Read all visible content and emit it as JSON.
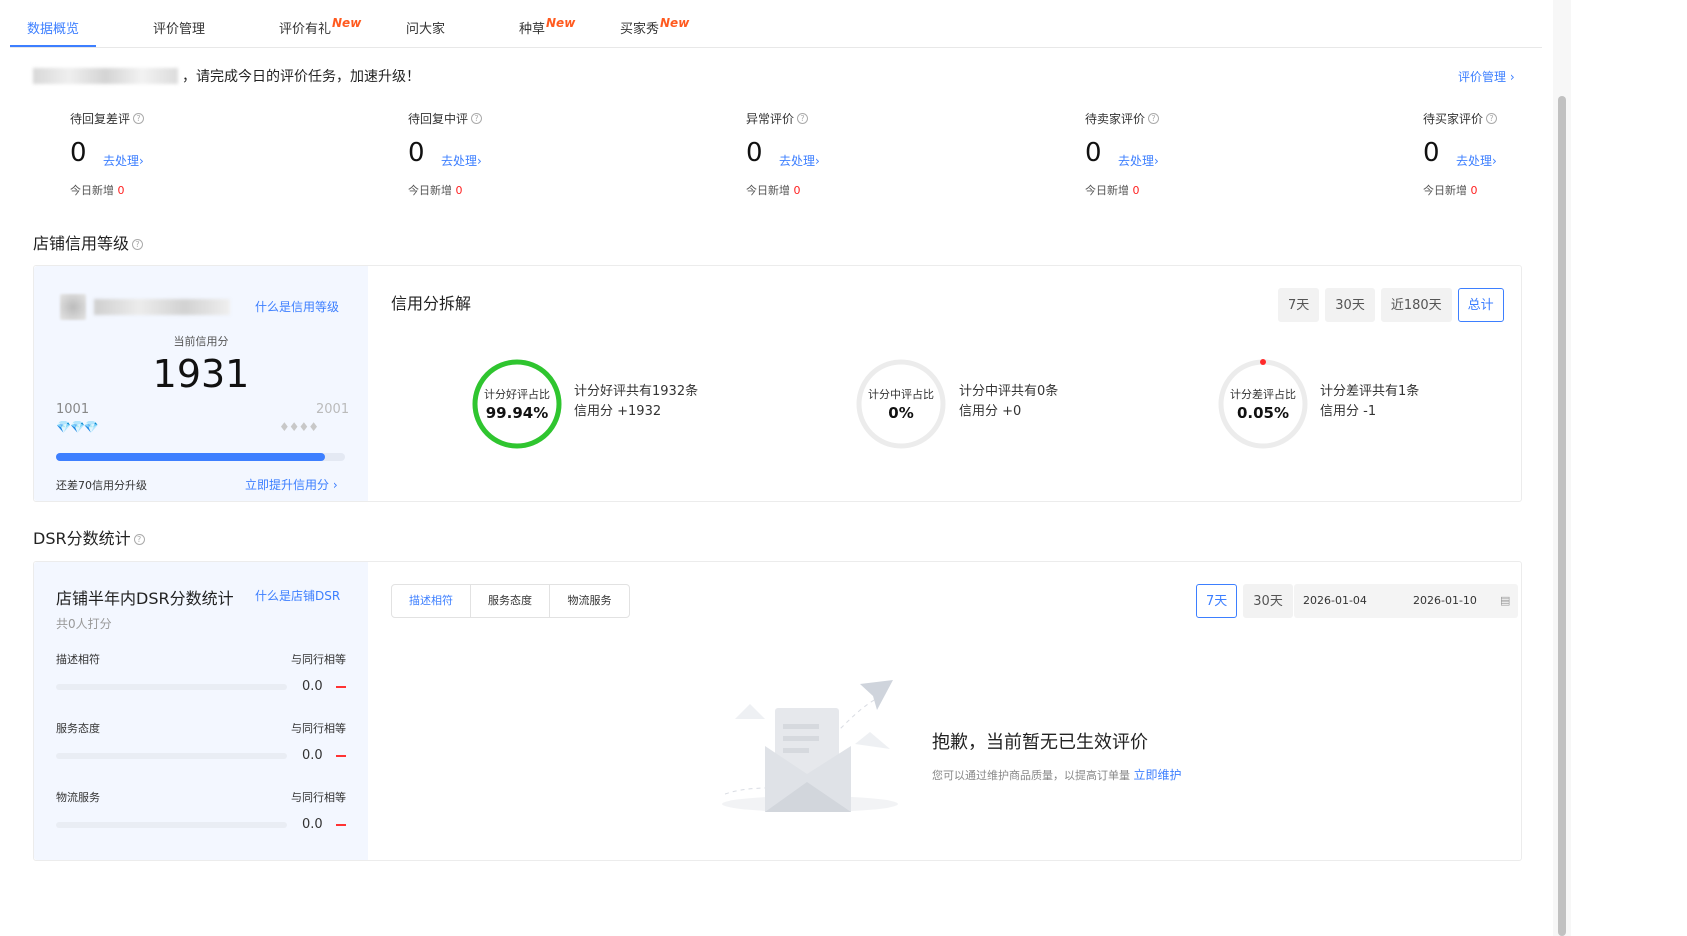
{
  "tabs": [
    {
      "label": "数据概览",
      "new": ""
    },
    {
      "label": "评价管理",
      "new": ""
    },
    {
      "label": "评价有礼",
      "new": "New"
    },
    {
      "label": "问大家",
      "new": ""
    },
    {
      "label": "种草",
      "new": "New"
    },
    {
      "label": "买家秀",
      "new": "New"
    }
  ],
  "notice": {
    "text": "，请完成今日的评价任务，加速升级！",
    "link": "评价管理"
  },
  "stats": [
    {
      "label": "待回复差评",
      "value": "0",
      "action": "去处理",
      "today_label": "今日新增",
      "today_value": "0"
    },
    {
      "label": "待回复中评",
      "value": "0",
      "action": "去处理",
      "today_label": "今日新增",
      "today_value": "0"
    },
    {
      "label": "异常评价",
      "value": "0",
      "action": "去处理",
      "today_label": "今日新增",
      "today_value": "0"
    },
    {
      "label": "待卖家评价",
      "value": "0",
      "action": "去处理",
      "today_label": "今日新增",
      "today_value": "0"
    },
    {
      "label": "待买家评价",
      "value": "0",
      "action": "去处理",
      "today_label": "今日新增",
      "today_value": "0"
    }
  ],
  "credit": {
    "section_title": "店铺信用等级",
    "what_link": "什么是信用等级",
    "current_label": "当前信用分",
    "score": "1931",
    "range_low": "1001",
    "range_high": "2001",
    "progress": 0.93,
    "remain_text": "还差70信用分升级",
    "boost_link": "立即提升信用分",
    "breakdown_title": "信用分拆解",
    "periods": [
      "7天",
      "30天",
      "近180天",
      "总计"
    ],
    "active_period": "总计",
    "items": [
      {
        "ring_label": "计分好评占比",
        "percent": "99.94%",
        "ratio": 0.9994,
        "color": "#2fc52f",
        "desc1": "计分好评共有1932条",
        "desc2": "信用分 +1932"
      },
      {
        "ring_label": "计分中评占比",
        "percent": "0%",
        "ratio": 0,
        "color": "#e0e0e0",
        "desc1": "计分中评共有0条",
        "desc2": "信用分 +0"
      },
      {
        "ring_label": "计分差评占比",
        "percent": "0.05%",
        "ratio": 0.0005,
        "color": "#ff2a2a",
        "desc1": "计分差评共有1条",
        "desc2": "信用分 -1"
      }
    ]
  },
  "dsr": {
    "section_title": "DSR分数统计",
    "card_title": "店铺半年内DSR分数统计",
    "what_link": "什么是店铺DSR",
    "count_text": "共0人打分",
    "rows": [
      {
        "label": "描述相符",
        "compare": "与同行相等",
        "value": "0.0"
      },
      {
        "label": "服务态度",
        "compare": "与同行相等",
        "value": "0.0"
      },
      {
        "label": "物流服务",
        "compare": "与同行相等",
        "value": "0.0"
      }
    ],
    "segments": [
      "描述相符",
      "服务态度",
      "物流服务"
    ],
    "periods": [
      "7天",
      "30天"
    ],
    "date_start": "2026-01-04",
    "date_end": "2026-01-10",
    "empty_title": "抱歉，当前暂无已生效评价",
    "empty_sub": "您可以通过维护商品质量，以提高订单量",
    "empty_link": "立即维护"
  }
}
